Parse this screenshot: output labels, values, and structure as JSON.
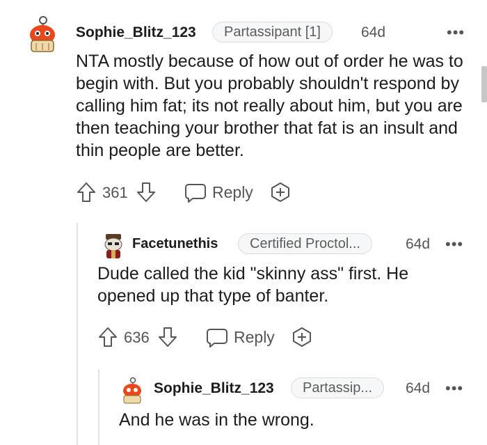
{
  "comments": [
    {
      "username": "Sophie_Blitz_123",
      "flair": "Partassipant [1]",
      "age": "64d",
      "more": "•••",
      "text": "NTA mostly because of how out of order he was to begin with. But you probably shouldn't respond by calling him fat; its not really about him, but you are then teaching your brother that fat is an insult and thin people are better.",
      "score": "361",
      "reply_label": "Reply"
    },
    {
      "username": "Facetunethis",
      "flair": "Certified Proctol...",
      "age": "64d",
      "more": "•••",
      "text": "Dude called the kid \"skinny ass\" first. He opened up that type of banter.",
      "score": "636",
      "reply_label": "Reply"
    },
    {
      "username": "Sophie_Blitz_123",
      "flair": "Partassip...",
      "age": "64d",
      "more": "•••",
      "text": "And he was in the wrong."
    }
  ],
  "icons": {
    "upvote": "upvote-arrow-icon",
    "downvote": "downvote-arrow-icon",
    "reply": "speech-bubble-icon",
    "award": "add-award-icon",
    "more": "more-dots-icon"
  },
  "colors": {
    "text": "#1c1c1c",
    "meta": "#555555",
    "flair_bg": "#f6f7f8",
    "thread_line": "#e1e3e6"
  }
}
